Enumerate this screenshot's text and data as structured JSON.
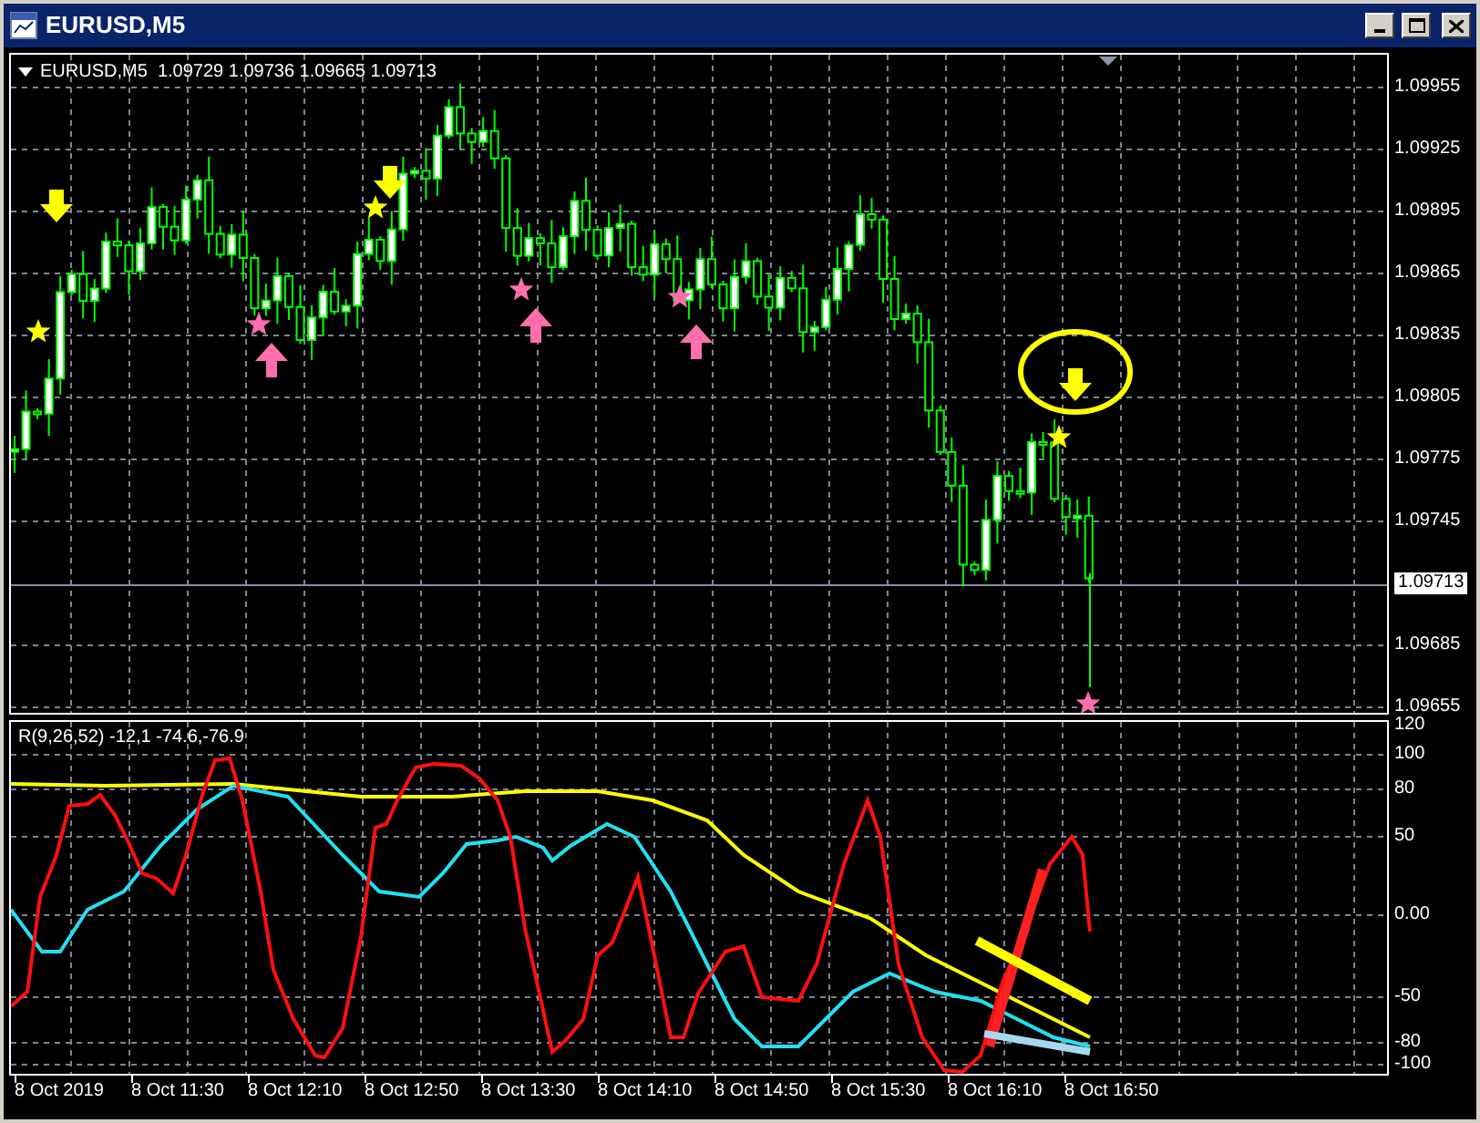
{
  "window": {
    "title": "EURUSD,M5"
  },
  "main_chart": {
    "legend": "EURUSD,M5  1.09729 1.09736 1.09665 1.09713",
    "price_axis": [
      "1.09955",
      "1.09925",
      "1.09895",
      "1.09865",
      "1.09835",
      "1.09805",
      "1.09775",
      "1.09745",
      "1.09685",
      "1.09655"
    ],
    "current_price": "1.09713"
  },
  "indicator": {
    "legend": "R(9,26,52) -12,1 -74.6,-76.9",
    "axis": [
      "120",
      "100",
      "80",
      "50",
      "0.00",
      "-50",
      "-80",
      "-100"
    ]
  },
  "time_axis": [
    "8 Oct 2019",
    "8 Oct 11:30",
    "8 Oct 12:10",
    "8 Oct 12:50",
    "8 Oct 13:30",
    "8 Oct 14:10",
    "8 Oct 14:50",
    "8 Oct 15:30",
    "8 Oct 16:10",
    "8 Oct 16:50"
  ]
}
